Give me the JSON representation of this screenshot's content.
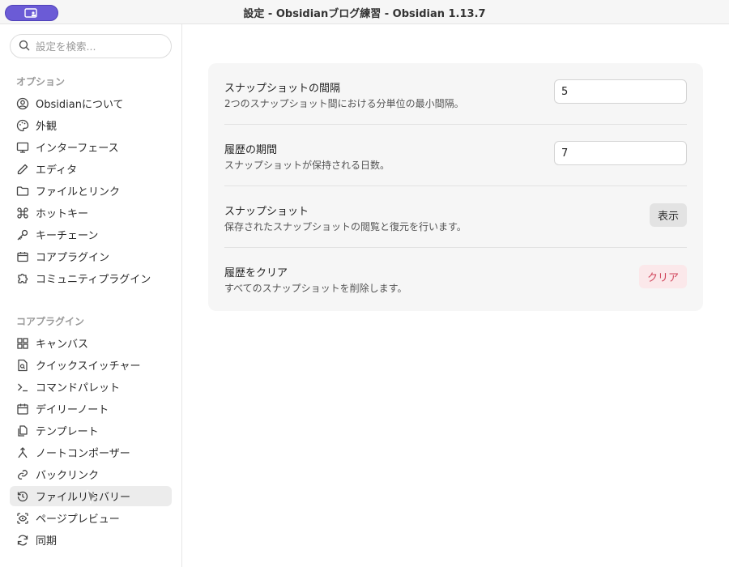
{
  "window": {
    "title": "設定 - Obsidianブログ練習 - Obsidian 1.13.7"
  },
  "search": {
    "placeholder": "設定を検索..."
  },
  "sidebar": {
    "options_title": "オプション",
    "options": [
      {
        "label": "Obsidianについて",
        "icon": "user-circle-icon"
      },
      {
        "label": "外観",
        "icon": "palette-icon"
      },
      {
        "label": "インターフェース",
        "icon": "monitor-icon"
      },
      {
        "label": "エディタ",
        "icon": "pencil-icon"
      },
      {
        "label": "ファイルとリンク",
        "icon": "folder-icon"
      },
      {
        "label": "ホットキー",
        "icon": "command-key-icon"
      },
      {
        "label": "キーチェーン",
        "icon": "key-icon"
      },
      {
        "label": "コアプラグイン",
        "icon": "calendar-box-icon"
      },
      {
        "label": "コミュニティプラグイン",
        "icon": "puzzle-icon"
      }
    ],
    "core_title": "コアプラグイン",
    "core": [
      {
        "label": "キャンバス",
        "icon": "layout-grid-icon"
      },
      {
        "label": "クイックスイッチャー",
        "icon": "file-search-icon"
      },
      {
        "label": "コマンドパレット",
        "icon": "terminal-icon"
      },
      {
        "label": "デイリーノート",
        "icon": "calendar-icon"
      },
      {
        "label": "テンプレート",
        "icon": "files-icon"
      },
      {
        "label": "ノートコンポーザー",
        "icon": "merge-icon"
      },
      {
        "label": "バックリンク",
        "icon": "link-back-icon"
      },
      {
        "label": "ファイルリカバリー",
        "icon": "history-icon",
        "active": true
      },
      {
        "label": "ページプレビュー",
        "icon": "scan-eye-icon"
      },
      {
        "label": "同期",
        "icon": "refresh-icon"
      }
    ]
  },
  "settings": [
    {
      "name": "スナップショットの間隔",
      "desc": "2つのスナップショット間における分単位の最小間隔。",
      "value": "5"
    },
    {
      "name": "履歴の期間",
      "desc": "スナップショットが保持される日数。",
      "value": "7"
    },
    {
      "name": "スナップショット",
      "desc": "保存されたスナップショットの閲覧と復元を行います。",
      "button": "表示"
    },
    {
      "name": "履歴をクリア",
      "desc": "すべてのスナップショットを削除します。",
      "button": "クリア"
    }
  ],
  "colors": {
    "accent": "#6b5bd6",
    "danger": "#d0455b",
    "panel_bg": "#f6f6f6"
  }
}
